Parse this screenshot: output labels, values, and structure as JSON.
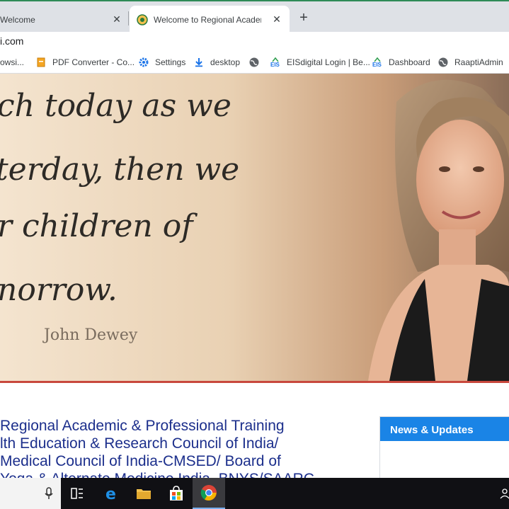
{
  "browser": {
    "tabs": [
      {
        "label": "Welcome",
        "active": false
      },
      {
        "label": "Welcome to Regional Academic & ",
        "active": true
      }
    ],
    "url": "i.com",
    "bookmarks": [
      {
        "label": "rowsi...",
        "icon": "page-icon"
      },
      {
        "label": "PDF Converter - Co...",
        "icon": "pdf-converter-icon"
      },
      {
        "label": "Settings",
        "icon": "gear-icon"
      },
      {
        "label": "desktop",
        "icon": "download-icon"
      },
      {
        "label": "",
        "icon": "globe-icon"
      },
      {
        "label": "EISdigital Login | Be...",
        "icon": "eis-icon"
      },
      {
        "label": "Dashboard",
        "icon": "eis-icon"
      },
      {
        "label": "RaaptiAdmin",
        "icon": "globe-icon"
      }
    ]
  },
  "hero": {
    "quote_lines": [
      "ch today as we",
      "terday, then we",
      "r children of",
      "norrow."
    ],
    "author": "John Dewey"
  },
  "main": {
    "title_lines": [
      "Regional Academic & Professional Training",
      "lth Education & Research Council of India/",
      "Medical Council of India-CMSED/ Board of",
      "Yoga & Alternate Medicine India, BNYS/SAARC"
    ],
    "news_heading": "News & Updates"
  },
  "taskbar": {
    "items": [
      "microphone-icon",
      "task-view-icon",
      "edge-icon",
      "file-explorer-icon",
      "store-icon",
      "chrome-icon"
    ]
  },
  "colors": {
    "title": "#1c2f8c",
    "news_header": "#1a84e6",
    "hero_divider": "#c8483d"
  }
}
